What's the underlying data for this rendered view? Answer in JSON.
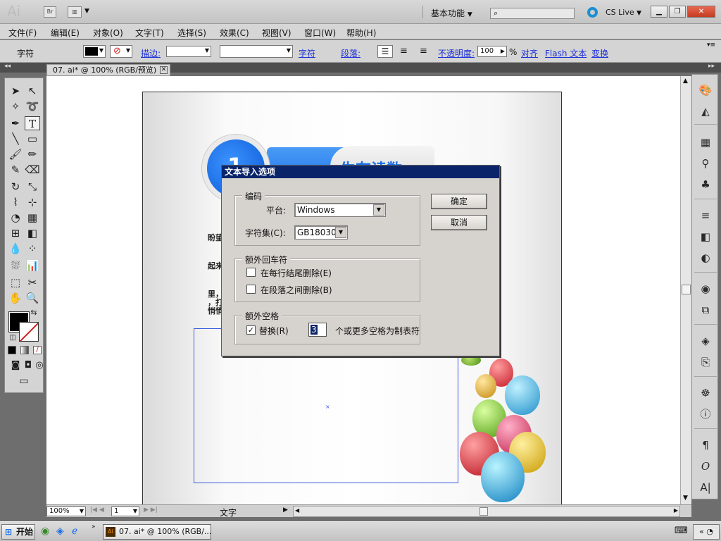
{
  "app": {
    "logo": "Ai",
    "bridge_label": "Br",
    "workspace": "基本功能",
    "cs_live": "CS Live"
  },
  "menu": [
    "文件(F)",
    "编辑(E)",
    "对象(O)",
    "文字(T)",
    "选择(S)",
    "效果(C)",
    "视图(V)",
    "窗口(W)",
    "帮助(H)"
  ],
  "controlbar": {
    "context": "字符",
    "stroke_label": "描边:",
    "char_link": "字符",
    "para_link": "段落:",
    "opacity_label": "不透明度:",
    "opacity_value": "100",
    "opacity_unit": "%",
    "align_link": "对齐",
    "flash_link": "Flash 文本",
    "transform_link": "变换"
  },
  "document": {
    "tab_title": "07. ai* @ 100% (RGB/预览)"
  },
  "artboard": {
    "number": "1",
    "heading": "生存读数",
    "lines": [
      "盼望",
      "起来",
      "里，",
      "，打",
      "悄悄"
    ]
  },
  "status": {
    "zoom": "100%",
    "artboard_num": "1",
    "mode": "文字"
  },
  "dialog": {
    "title": "文本导入选项",
    "encoding_group": "编码",
    "platform_label": "平台:",
    "platform_value": "Windows",
    "charset_label": "字符集(C):",
    "charset_value": "GB18030",
    "returns_group": "额外回车符",
    "remove_line_ends": "在每行结尾删除(E)",
    "remove_between_paragraphs": "在段落之间删除(B)",
    "spaces_group": "额外空格",
    "replace_label": "替换(R)",
    "replace_count": "3",
    "replace_suffix": "个或更多空格为制表符",
    "ok": "确定",
    "cancel": "取消"
  },
  "taskbar": {
    "start": "开始",
    "task": "07. ai* @ 100% (RGB/..."
  },
  "icons": {
    "tools": [
      "selection-icon",
      "direct-selection-icon",
      "magic-wand-icon",
      "lasso-icon",
      "pen-icon",
      "type-icon",
      "line-icon",
      "rectangle-icon",
      "paintbrush-icon",
      "pencil-icon",
      "blob-brush-icon",
      "eraser-icon",
      "rotate-icon",
      "scale-icon",
      "warp-icon",
      "free-transform-icon",
      "shape-builder-icon",
      "perspective-grid-icon",
      "mesh-icon",
      "gradient-icon",
      "eyedropper-icon",
      "blend-icon",
      "symbol-sprayer-icon",
      "graph-icon",
      "artboard-icon",
      "slice-icon",
      "hand-icon",
      "zoom-icon"
    ],
    "right_panel": [
      "color-guide-icon",
      "color-icon",
      "swatches-icon",
      "brushes-icon",
      "symbols-icon",
      "stroke-icon",
      "gradient-panel-icon",
      "transparency-icon",
      "appearance-icon",
      "graphic-styles-icon",
      "layers-icon",
      "artboards-panel-icon",
      "navigator-icon",
      "info-icon",
      "paragraph-icon",
      "opentype-icon",
      "character-icon"
    ]
  },
  "colors": {
    "dialog_title_bg": "#0a246a",
    "link": "#1b2fd8",
    "art_blue": "#1a6fe6",
    "text_frame": "#3a5cdb"
  }
}
